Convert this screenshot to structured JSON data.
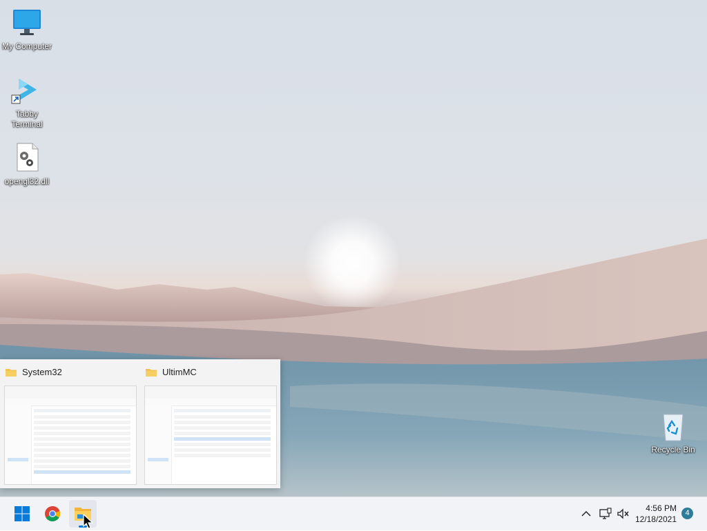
{
  "desktop": {
    "icons": [
      {
        "label": "My Computer",
        "icon": "monitor-icon"
      },
      {
        "label": "Tabby Terminal",
        "icon": "tabby-terminal-icon"
      },
      {
        "label": "opengl32.dll",
        "icon": "dll-file-icon"
      },
      {
        "label": "Recycle Bin",
        "icon": "recycle-bin-icon"
      }
    ]
  },
  "taskbar": {
    "pinned": [
      {
        "name": "Start",
        "icon": "windows-start-icon"
      },
      {
        "name": "Google Chrome",
        "icon": "chrome-icon"
      },
      {
        "name": "File Explorer",
        "icon": "file-explorer-icon"
      }
    ],
    "tray": {
      "time": "4:56 PM",
      "date": "12/18/2021",
      "notification_count": "4",
      "icons": [
        "chevron-up-icon",
        "network-icon",
        "volume-muted-icon"
      ]
    }
  },
  "previews": [
    {
      "title": "System32",
      "icon": "folder-icon"
    },
    {
      "title": "UltimMC",
      "icon": "folder-icon"
    }
  ],
  "colors": {
    "taskbar_bg": "#f1f3f7",
    "accent": "#0078d4",
    "badge": "#2d7d9a",
    "folder": "#f2c14e"
  }
}
